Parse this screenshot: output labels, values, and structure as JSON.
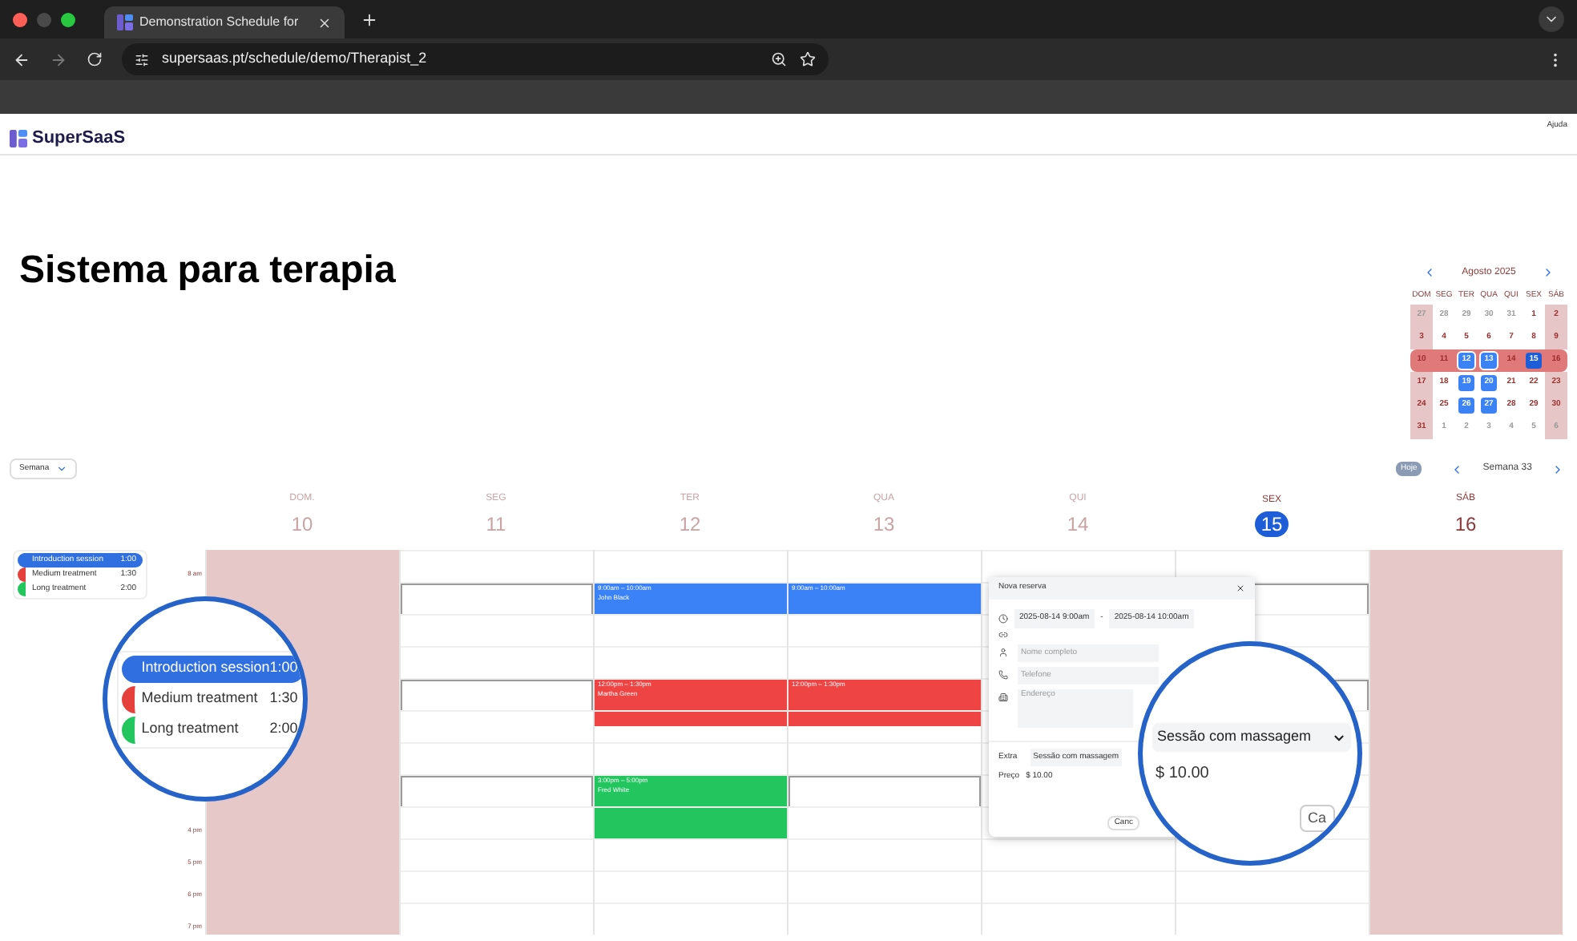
{
  "browser": {
    "tab_title": "Demonstration Schedule for",
    "url": "supersaas.pt/schedule/demo/Therapist_2"
  },
  "header": {
    "logo": "SuperSaaS",
    "help": "Ajuda"
  },
  "title": "Sistema para terapia",
  "mini_calendar": {
    "month": "Agosto 2025",
    "weekdays": [
      "DOM",
      "SEG",
      "TER",
      "QUA",
      "QUI",
      "SEX",
      "SÁB"
    ],
    "weeks": [
      {
        "selected": false,
        "days": [
          {
            "text": "27",
            "kind": "out"
          },
          {
            "text": "28",
            "kind": "out"
          },
          {
            "text": "29",
            "kind": "out"
          },
          {
            "text": "30",
            "kind": "out"
          },
          {
            "text": "31",
            "kind": "out"
          },
          {
            "text": "1",
            "kind": "in"
          },
          {
            "text": "2",
            "kind": "in"
          }
        ]
      },
      {
        "selected": false,
        "days": [
          {
            "text": "3",
            "kind": "in"
          },
          {
            "text": "4",
            "kind": "in"
          },
          {
            "text": "5",
            "kind": "in"
          },
          {
            "text": "6",
            "kind": "in"
          },
          {
            "text": "7",
            "kind": "in"
          },
          {
            "text": "8",
            "kind": "in"
          },
          {
            "text": "9",
            "kind": "in"
          }
        ]
      },
      {
        "selected": true,
        "days": [
          {
            "text": "10",
            "kind": "in"
          },
          {
            "text": "11",
            "kind": "in"
          },
          {
            "text": "12",
            "kind": "available"
          },
          {
            "text": "13",
            "kind": "available"
          },
          {
            "text": "14",
            "kind": "in"
          },
          {
            "text": "15",
            "kind": "today"
          },
          {
            "text": "16",
            "kind": "in"
          }
        ]
      },
      {
        "selected": false,
        "days": [
          {
            "text": "17",
            "kind": "in"
          },
          {
            "text": "18",
            "kind": "in"
          },
          {
            "text": "19",
            "kind": "available"
          },
          {
            "text": "20",
            "kind": "available"
          },
          {
            "text": "21",
            "kind": "in"
          },
          {
            "text": "22",
            "kind": "in"
          },
          {
            "text": "23",
            "kind": "in"
          }
        ]
      },
      {
        "selected": false,
        "days": [
          {
            "text": "24",
            "kind": "in"
          },
          {
            "text": "25",
            "kind": "in"
          },
          {
            "text": "26",
            "kind": "available"
          },
          {
            "text": "27",
            "kind": "available"
          },
          {
            "text": "28",
            "kind": "in"
          },
          {
            "text": "29",
            "kind": "in"
          },
          {
            "text": "30",
            "kind": "in"
          }
        ]
      },
      {
        "selected": false,
        "days": [
          {
            "text": "31",
            "kind": "in"
          },
          {
            "text": "1",
            "kind": "out"
          },
          {
            "text": "2",
            "kind": "out"
          },
          {
            "text": "3",
            "kind": "out"
          },
          {
            "text": "4",
            "kind": "out"
          },
          {
            "text": "5",
            "kind": "out"
          },
          {
            "text": "6",
            "kind": "out"
          }
        ]
      }
    ]
  },
  "toolbar": {
    "view": "Semana",
    "today": "Hoje",
    "week": "Semana 33"
  },
  "legend": [
    {
      "name": "Introduction session",
      "duration": "1:00",
      "color": "#2f6fe0",
      "selected": true
    },
    {
      "name": "Medium treatment",
      "duration": "1:30",
      "color": "#e5403c",
      "selected": false
    },
    {
      "name": "Long treatment",
      "duration": "2:00",
      "color": "#22c55e",
      "selected": false
    }
  ],
  "time_label_top": "8 am",
  "time_labels_bottom": [
    "4 pm",
    "5 pm",
    "6 pm",
    "7 pm"
  ],
  "days": [
    {
      "name": "DOM.",
      "number": "10",
      "closed": true,
      "selected": false
    },
    {
      "name": "SEG",
      "number": "11",
      "closed": false,
      "selected": false,
      "free_slots": [
        false,
        true,
        false,
        false,
        true,
        false,
        false,
        true,
        false,
        false,
        false,
        false
      ]
    },
    {
      "name": "TER",
      "number": "12",
      "closed": false,
      "selected": false,
      "events": [
        {
          "time": "9:00am – 10:00am",
          "name": "John Black",
          "color": "#3b82f6"
        },
        {
          "time": "12:00pm – 1:30pm",
          "name": "Martha Green",
          "color": "#ef4444"
        },
        {
          "time": "3:00pm – 5:00pm",
          "name": "Fred White",
          "color": "#22c55e"
        }
      ]
    },
    {
      "name": "QUA",
      "number": "13",
      "closed": false,
      "selected": false,
      "free_slots": [
        false,
        false,
        false,
        false,
        false,
        false,
        false,
        true,
        false,
        false,
        false,
        false
      ],
      "events": [
        {
          "time": "9:00am – 10:00am",
          "color": "#3b82f6"
        },
        {
          "time": "12:00pm – 1:30pm",
          "color": "#ef4444"
        }
      ]
    },
    {
      "name": "QUI",
      "number": "14",
      "closed": false,
      "selected": false,
      "free_slots": [
        false,
        false,
        false,
        false,
        false,
        false,
        false,
        false,
        false,
        false,
        false,
        false
      ]
    },
    {
      "name": "SEX",
      "number": "15",
      "closed": false,
      "selected": true,
      "free_slots": [
        false,
        true,
        false,
        false,
        true,
        false,
        false,
        false,
        false,
        false,
        false,
        false
      ]
    },
    {
      "name": "SÁB",
      "number": "16",
      "closed": true,
      "selected": false
    }
  ],
  "booking_popup": {
    "title": "Nova reserva",
    "start": "2025-08-14 9:00am",
    "separator": "-",
    "end": "2025-08-14 10:00am",
    "fields": [
      {
        "placeholder": "Nome completo",
        "kind": "input"
      },
      {
        "placeholder": "Telefone",
        "kind": "input"
      },
      {
        "placeholder": "Endereço",
        "kind": "textarea"
      }
    ],
    "extra_label": "Extra",
    "extra_value": "Sessão com massagem",
    "price_label": "Preço",
    "price": "$ 10.00",
    "cancel": "Canc"
  },
  "magnifier_left": {
    "items": [
      {
        "name": "Introduction session",
        "duration": "1:00",
        "color": "#2f6fe0",
        "selected": true
      },
      {
        "name": "Medium treatment",
        "duration": "1:30",
        "color": "#e5403c",
        "selected": false
      },
      {
        "name": "Long treatment",
        "duration": "2:00",
        "color": "#22c55e",
        "selected": false
      }
    ]
  },
  "magnifier_right": {
    "extra_value": "Sessão com massagem",
    "price": "$ 10.00",
    "button": "Ca"
  }
}
